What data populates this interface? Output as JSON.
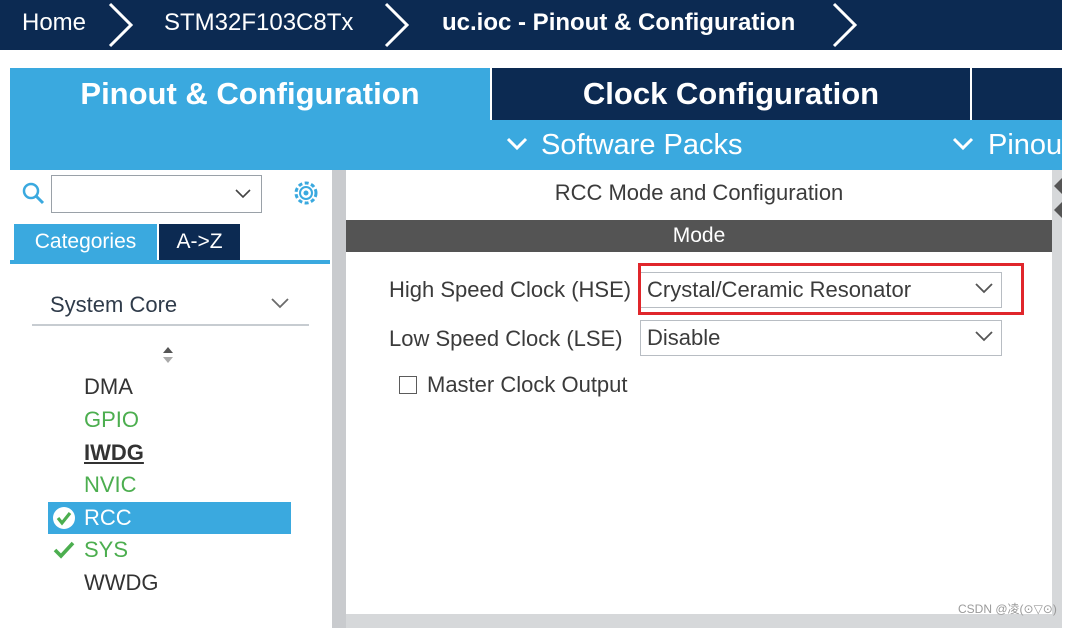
{
  "breadcrumb": {
    "items": [
      "Home",
      "STM32F103C8Tx",
      "uc.ioc - Pinout & Configuration"
    ]
  },
  "tabs": {
    "pinout": "Pinout & Configuration",
    "clock": "Clock Configuration"
  },
  "subtabs": {
    "software_packs": "Software Packs",
    "pinout": "Pinou"
  },
  "sidebar": {
    "search": {
      "value": "",
      "placeholder": ""
    },
    "view_tabs": [
      "Categories",
      "A->Z"
    ],
    "category": "System Core",
    "items": [
      {
        "label": "DMA",
        "state": "normal"
      },
      {
        "label": "GPIO",
        "state": "configured"
      },
      {
        "label": "IWDG",
        "state": "bold"
      },
      {
        "label": "NVIC",
        "state": "configured"
      },
      {
        "label": "RCC",
        "state": "selected-checked"
      },
      {
        "label": "SYS",
        "state": "checked"
      },
      {
        "label": "WWDG",
        "state": "normal"
      }
    ]
  },
  "main": {
    "title": "RCC Mode and Configuration",
    "section": "Mode",
    "hse_label": "High Speed Clock (HSE)",
    "hse_value": "Crystal/Ceramic Resonator",
    "lse_label": "Low Speed Clock (LSE)",
    "lse_value": "Disable",
    "mco_label": "Master Clock Output",
    "mco_checked": false
  },
  "watermark": "CSDN @凌(⊙▽⊙)",
  "colors": {
    "navy": "#0c2a52",
    "accent": "#3aa9df",
    "green": "#4cae4f",
    "highlight_red": "#e0262b"
  }
}
